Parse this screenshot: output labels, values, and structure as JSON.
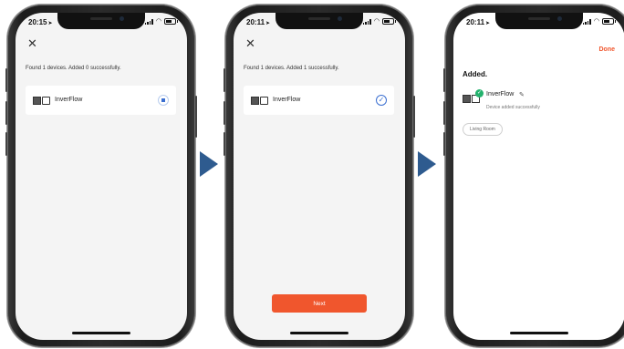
{
  "screens": [
    {
      "time": "20:15",
      "close_icon": "close-icon",
      "status_text": "Found 1 devices. Added 0 successfully.",
      "device_name": "InverFlow",
      "device_state": "adding"
    },
    {
      "time": "20:11",
      "close_icon": "close-icon",
      "status_text": "Found 1 devices. Added 1 successfully.",
      "device_name": "InverFlow",
      "device_state": "added",
      "next_label": "Next"
    },
    {
      "time": "20:11",
      "done_label": "Done",
      "title": "Added.",
      "device_name": "InverFlow",
      "device_subtitle": "Device added successfully",
      "room_label": "Living Room"
    }
  ],
  "colors": {
    "accent": "#f0562d",
    "check_blue": "#3b6fd1",
    "success_green": "#23b26d",
    "flow_arrow": "#2e5b8f"
  },
  "icons": [
    "close-icon",
    "check-icon",
    "spinner-icon",
    "edit-icon",
    "device-icon",
    "location-arrow-icon",
    "signal-icon",
    "wifi-icon",
    "battery-icon",
    "flow-arrow"
  ]
}
